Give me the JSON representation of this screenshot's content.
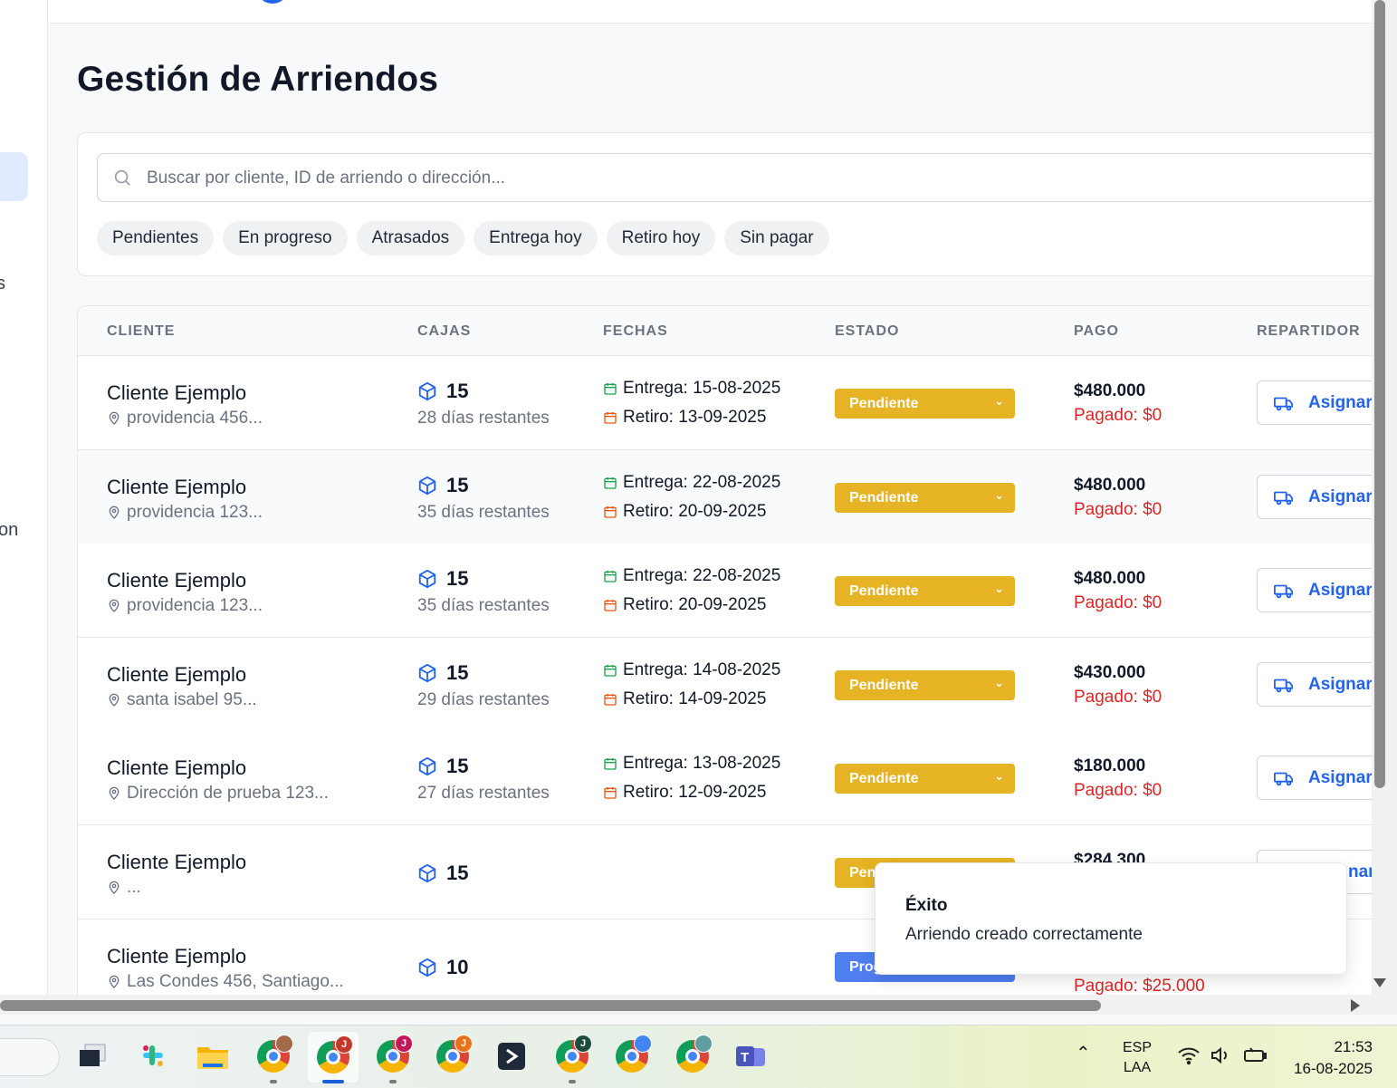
{
  "page": {
    "title": "Gestión de Arriendos"
  },
  "sidebar": {
    "fragment_1": "s",
    "fragment_2": "on"
  },
  "search": {
    "placeholder": "Buscar por cliente, ID de arriendo o dirección...",
    "value": ""
  },
  "filters": [
    "Pendientes",
    "En progreso",
    "Atrasados",
    "Entrega hoy",
    "Retiro hoy",
    "Sin pagar"
  ],
  "table": {
    "headers": {
      "cliente": "CLIENTE",
      "cajas": "CAJAS",
      "fechas": "FECHAS",
      "estado": "ESTADO",
      "pago": "PAGO",
      "repartidor": "REPARTIDOR"
    },
    "rows": [
      {
        "client": "Cliente Ejemplo",
        "address": "providencia 456...",
        "boxes": "15",
        "days_left": "28 días restantes",
        "delivery": "Entrega: 15-08-2025",
        "pickup": "Retiro: 13-09-2025",
        "status": "Pendiente",
        "amount": "$480.000",
        "paid": "Pagado: $0",
        "assign": "Asignar"
      },
      {
        "client": "Cliente Ejemplo",
        "address": "providencia 123...",
        "boxes": "15",
        "days_left": "35 días restantes",
        "delivery": "Entrega: 22-08-2025",
        "pickup": "Retiro: 20-09-2025",
        "status": "Pendiente",
        "amount": "$480.000",
        "paid": "Pagado: $0",
        "assign": "Asignar"
      },
      {
        "client": "Cliente Ejemplo",
        "address": "providencia 123...",
        "boxes": "15",
        "days_left": "35 días restantes",
        "delivery": "Entrega: 22-08-2025",
        "pickup": "Retiro: 20-09-2025",
        "status": "Pendiente",
        "amount": "$480.000",
        "paid": "Pagado: $0",
        "assign": "Asignar"
      },
      {
        "client": "Cliente Ejemplo",
        "address": "santa isabel 95...",
        "boxes": "15",
        "days_left": "29 días restantes",
        "delivery": "Entrega: 14-08-2025",
        "pickup": "Retiro: 14-09-2025",
        "status": "Pendiente",
        "amount": "$430.000",
        "paid": "Pagado: $0",
        "assign": "Asignar"
      },
      {
        "client": "Cliente Ejemplo",
        "address": "Dirección de prueba 123...",
        "boxes": "15",
        "days_left": "27 días restantes",
        "delivery": "Entrega: 13-08-2025",
        "pickup": "Retiro: 12-09-2025",
        "status": "Pendiente",
        "amount": "$180.000",
        "paid": "Pagado: $0",
        "assign": "Asignar"
      },
      {
        "client": "Cliente Ejemplo",
        "address": "...",
        "boxes": "15",
        "status": "Pen",
        "amount": "$284.300",
        "assign": "nar"
      },
      {
        "client": "Cliente Ejemplo",
        "address": "Las Condes 456, Santiago...",
        "boxes": "10",
        "status": "Prog",
        "paid": "Pagado: $25.000"
      }
    ]
  },
  "toast": {
    "title": "Éxito",
    "message": "Arriendo creado correctamente"
  },
  "taskbar": {
    "language_line1": "ESP",
    "language_line2": "LAA",
    "time": "21:53",
    "date": "16-08-2025",
    "badge_letter": "J"
  },
  "colors": {
    "status_pending": "#e6b325",
    "status_progress": "#4f7ef0",
    "unpaid_red": "#dc2626",
    "accent_blue": "#2563eb"
  },
  "icons": [
    "search-icon",
    "package-icon",
    "map-pin-icon",
    "calendar-icon",
    "truck-icon",
    "chevron-down-icon"
  ]
}
